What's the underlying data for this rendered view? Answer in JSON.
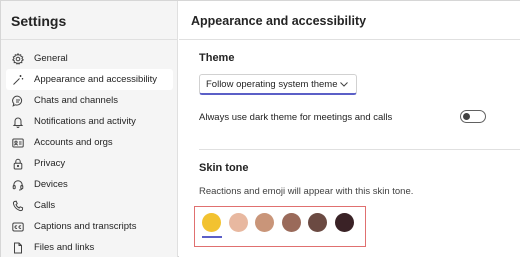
{
  "sidebar": {
    "title": "Settings",
    "items": [
      {
        "label": "General",
        "icon": "gear-icon"
      },
      {
        "label": "Appearance and accessibility",
        "icon": "magic-wand-icon",
        "selected": true
      },
      {
        "label": "Chats and channels",
        "icon": "chat-icon"
      },
      {
        "label": "Notifications and activity",
        "icon": "bell-icon"
      },
      {
        "label": "Accounts and orgs",
        "icon": "person-card-icon"
      },
      {
        "label": "Privacy",
        "icon": "lock-icon"
      },
      {
        "label": "Devices",
        "icon": "headset-icon"
      },
      {
        "label": "Calls",
        "icon": "phone-icon"
      },
      {
        "label": "Captions and transcripts",
        "icon": "closed-captions-icon"
      },
      {
        "label": "Files and links",
        "icon": "document-icon"
      }
    ]
  },
  "main": {
    "title": "Appearance and accessibility",
    "theme": {
      "heading": "Theme",
      "selected": "Follow operating system theme",
      "dark_toggle_label": "Always use dark theme for meetings and calls",
      "dark_toggle_on": false
    },
    "skin_tone": {
      "heading": "Skin tone",
      "description": "Reactions and emoji will appear with this skin tone.",
      "tones": [
        "#f2c230",
        "#e8b8a0",
        "#c99579",
        "#9a6a5a",
        "#6b4a42",
        "#3a2226"
      ],
      "selected_index": 0
    }
  },
  "colors": {
    "accent": "#5b5fc7",
    "highlight_border": "#e07070"
  }
}
